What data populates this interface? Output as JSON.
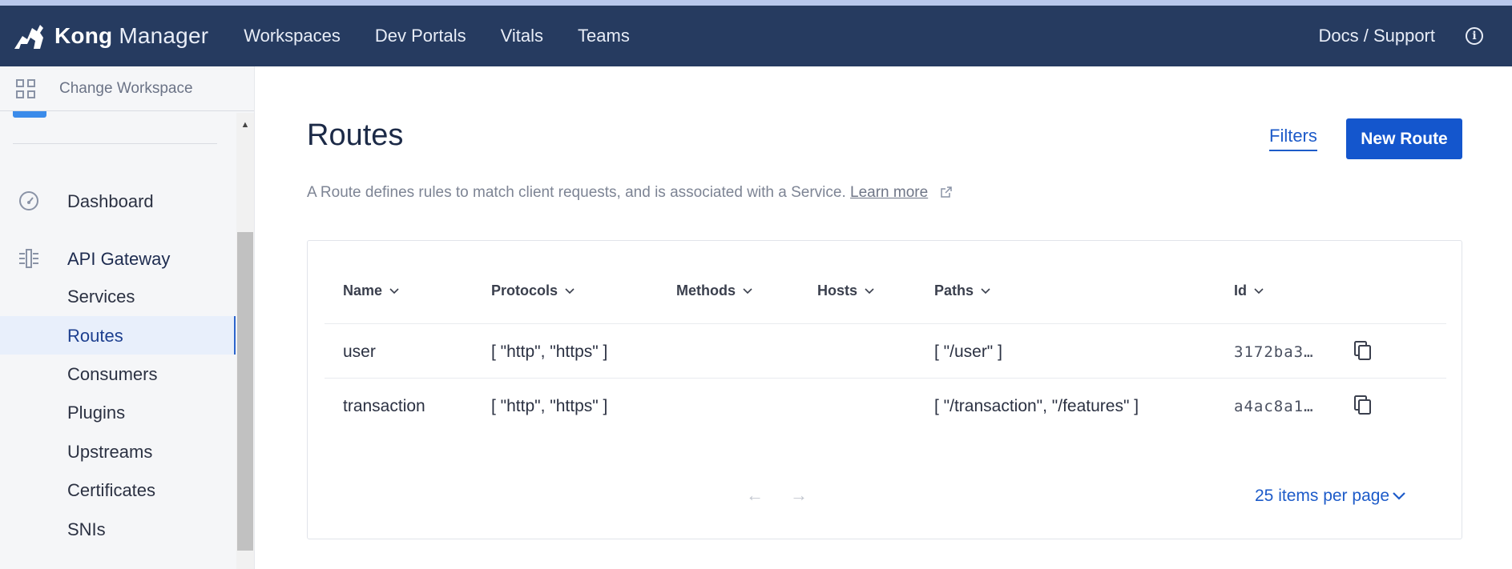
{
  "app": {
    "brand_bold": "Kong",
    "brand_light": "Manager",
    "nav": [
      "Workspaces",
      "Dev Portals",
      "Vitals",
      "Teams"
    ],
    "docs_label": "Docs / Support",
    "info_icon": "info-icon"
  },
  "sidebar": {
    "workspace_label": "Change Workspace",
    "dashboard": "Dashboard",
    "group_label": "API Gateway",
    "items": [
      "Services",
      "Routes",
      "Consumers",
      "Plugins",
      "Upstreams",
      "Certificates",
      "SNIs"
    ],
    "active_item": "Routes"
  },
  "page": {
    "title": "Routes",
    "filters_label": "Filters",
    "new_button": "New Route",
    "description": "A Route defines rules to match client requests, and is associated with a Service.",
    "learn_more": "Learn more"
  },
  "table": {
    "columns": [
      "Name",
      "Protocols",
      "Methods",
      "Hosts",
      "Paths",
      "Id"
    ],
    "rows": [
      {
        "name": "user",
        "protocols": "[ \"http\", \"https\" ]",
        "methods": "",
        "hosts": "",
        "paths": "[ \"/user\" ]",
        "id": "3172ba3…"
      },
      {
        "name": "transaction",
        "protocols": "[ \"http\", \"https\" ]",
        "methods": "",
        "hosts": "",
        "paths": "[ \"/transaction\", \"/features\" ]",
        "id": "a4ac8a1…"
      }
    ],
    "prev_arrow": "←",
    "next_arrow": "→",
    "per_page": "25 items per page"
  },
  "colors": {
    "navbar": "#263b60",
    "accent": "#1456cd",
    "sidebar_bg": "#f5f6f8",
    "active_bg": "#e8effb"
  }
}
